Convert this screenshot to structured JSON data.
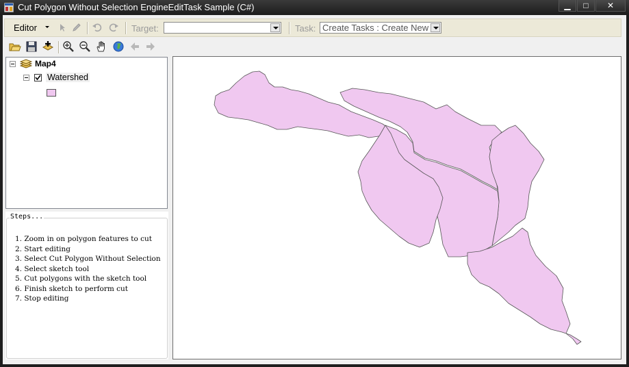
{
  "window": {
    "title": "Cut Polygon Without Selection EngineEditTask Sample (C#)",
    "controls": {
      "minimize": "▁",
      "maximize": "□",
      "close": "✕"
    }
  },
  "editor_toolbar": {
    "editor_label": "Editor",
    "target_label": "Target:",
    "target_value": "",
    "task_label": "Task:",
    "task_value": "Create Tasks : Create New"
  },
  "toc": {
    "map_name": "Map4",
    "layer_name": "Watershed",
    "layer_checked": true,
    "symbol_color": "#f0c8f0"
  },
  "steps": {
    "title": "Steps...",
    "items": [
      "1. Zoom in on polygon features to cut",
      "2. Start editing",
      "3. Select Cut Polygon Without Selection",
      "4. Select sketch tool",
      "5. Cut polygons with the sketch tool",
      "6. Finish sketch to perform cut",
      "7. Stop editing"
    ]
  },
  "map": {
    "fill_color": "#f0c8f0",
    "outline_color": "#555555"
  },
  "icons": {
    "editor_dropdown": "chevron-down-icon",
    "edit_tool": "arrow-icon",
    "sketch_tool": "pencil-icon",
    "undo": "undo-icon",
    "redo": "redo-icon",
    "open": "open-folder-icon",
    "save": "save-icon",
    "add_data": "add-data-icon",
    "zoom_in": "zoom-in-icon",
    "zoom_out": "zoom-out-icon",
    "pan": "pan-hand-icon",
    "full_extent": "globe-icon",
    "back": "back-arrow-icon",
    "forward": "forward-arrow-icon"
  }
}
